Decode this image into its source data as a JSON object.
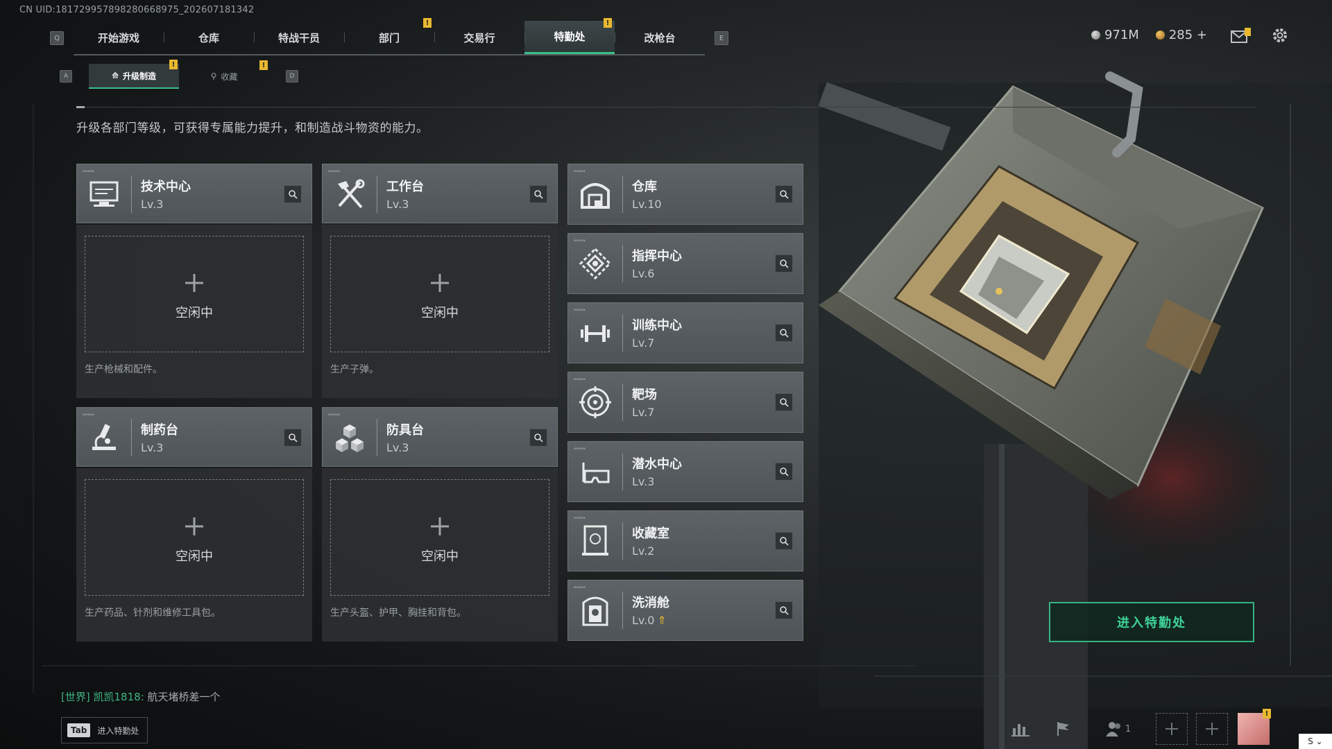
{
  "uid": "CN UID:18172995789828066897­5_202607181342",
  "nav": {
    "left_key": "Q",
    "right_key": "E",
    "tabs": [
      {
        "label": "开始游戏",
        "active": false,
        "alert": false
      },
      {
        "label": "仓库",
        "active": false,
        "alert": false
      },
      {
        "label": "特战干员",
        "active": false,
        "alert": false
      },
      {
        "label": "部门",
        "active": false,
        "alert": true
      },
      {
        "label": "交易行",
        "active": false,
        "alert": false
      },
      {
        "label": "特勤处",
        "active": true,
        "alert": true
      },
      {
        "label": "改枪台",
        "active": false,
        "alert": false
      }
    ]
  },
  "currency": {
    "silver": "971M",
    "gold": "285"
  },
  "alert_mark": "!",
  "sub_nav": {
    "left_key": "A",
    "right_key": "D",
    "tabs": [
      {
        "label": "升级制造",
        "active": true
      },
      {
        "label": "收藏",
        "active": false
      }
    ]
  },
  "description": "升级各部门等级，可获得专属能力提升，和制造战斗物资的能力。",
  "production_stations": [
    {
      "name": "技术中心",
      "level": "Lv.3",
      "status": "空闲中",
      "produces": "生产枪械和配件。",
      "icon": "computer-icon"
    },
    {
      "name": "工作台",
      "level": "Lv.3",
      "status": "空闲中",
      "produces": "生产子弹。",
      "icon": "tools-icon"
    },
    {
      "name": "制药台",
      "level": "Lv.3",
      "status": "空闲中",
      "produces": "生产药品、针剂和维修工具包。",
      "icon": "microscope-icon"
    },
    {
      "name": "防具台",
      "level": "Lv.3",
      "status": "空闲中",
      "produces": "生产头盔、护甲、胸挂和背包。",
      "icon": "cubes-icon"
    }
  ],
  "departments": [
    {
      "name": "仓库",
      "level": "Lv.10",
      "icon": "warehouse-icon"
    },
    {
      "name": "指挥中心",
      "level": "Lv.6",
      "icon": "command-icon"
    },
    {
      "name": "训练中心",
      "level": "Lv.7",
      "icon": "dumbbell-icon"
    },
    {
      "name": "靶场",
      "level": "Lv.7",
      "icon": "target-icon"
    },
    {
      "name": "潜水中心",
      "level": "Lv.3",
      "icon": "diving-mask-icon"
    },
    {
      "name": "收藏室",
      "level": "Lv.2",
      "icon": "trophy-case-icon"
    },
    {
      "name": "洗消舱",
      "level": "Lv.0",
      "icon": "decon-icon",
      "upgradable": true
    }
  ],
  "enter_button": "进入特勤处",
  "chat": {
    "channel": "[世界]",
    "user": "凯凯1818",
    "message": "航天堵桥差一个"
  },
  "tab_hint": {
    "key": "Tab",
    "label": "进入特勤处"
  },
  "bottom": {
    "friends_count": "1"
  },
  "colors": {
    "accent": "#39c08a",
    "alert": "#e8b830",
    "panel": "#4e5457"
  }
}
